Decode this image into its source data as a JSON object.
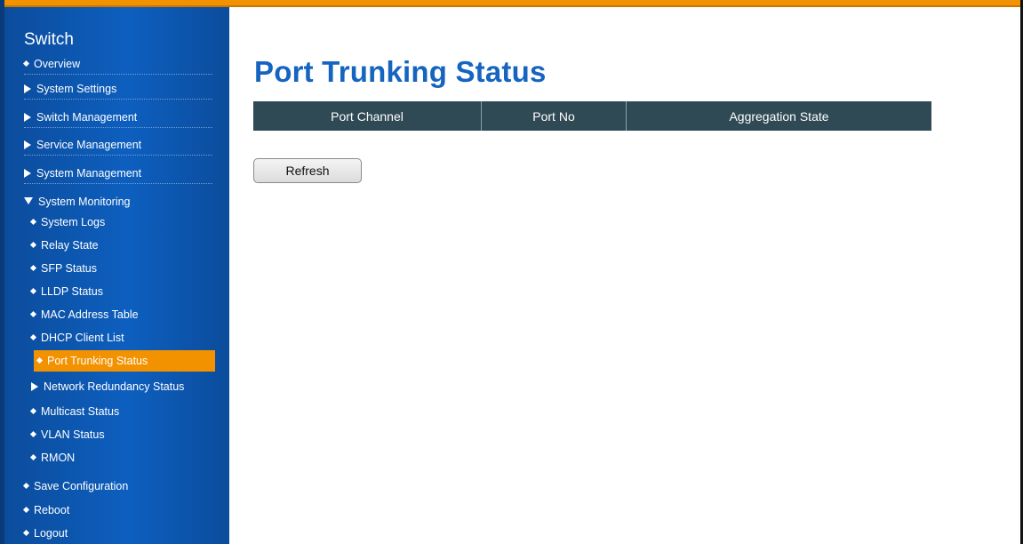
{
  "sidebar": {
    "title": "Switch",
    "items": [
      {
        "label": "Overview"
      },
      {
        "label": "System Settings"
      },
      {
        "label": "Switch Management"
      },
      {
        "label": "Service Management"
      },
      {
        "label": "System Management"
      },
      {
        "label": "System Monitoring"
      },
      {
        "label": "System Logs"
      },
      {
        "label": "Relay State"
      },
      {
        "label": "SFP Status"
      },
      {
        "label": "LLDP Status"
      },
      {
        "label": "MAC Address Table"
      },
      {
        "label": "DHCP Client List"
      },
      {
        "label": "Port Trunking Status"
      },
      {
        "label": "Network Redundancy Status"
      },
      {
        "label": "Multicast Status"
      },
      {
        "label": "VLAN Status"
      },
      {
        "label": "RMON"
      },
      {
        "label": "Save Configuration"
      },
      {
        "label": "Reboot"
      },
      {
        "label": "Logout"
      }
    ]
  },
  "main": {
    "title": "Port Trunking Status",
    "table": {
      "headers": [
        "Port Channel",
        "Port No",
        "Aggregation State"
      ]
    },
    "refresh_label": "Refresh"
  },
  "colors": {
    "sidebar_bg": "#0d5fbf",
    "active_item": "#f39200",
    "title": "#1565c0",
    "table_header": "#2f4a55"
  }
}
